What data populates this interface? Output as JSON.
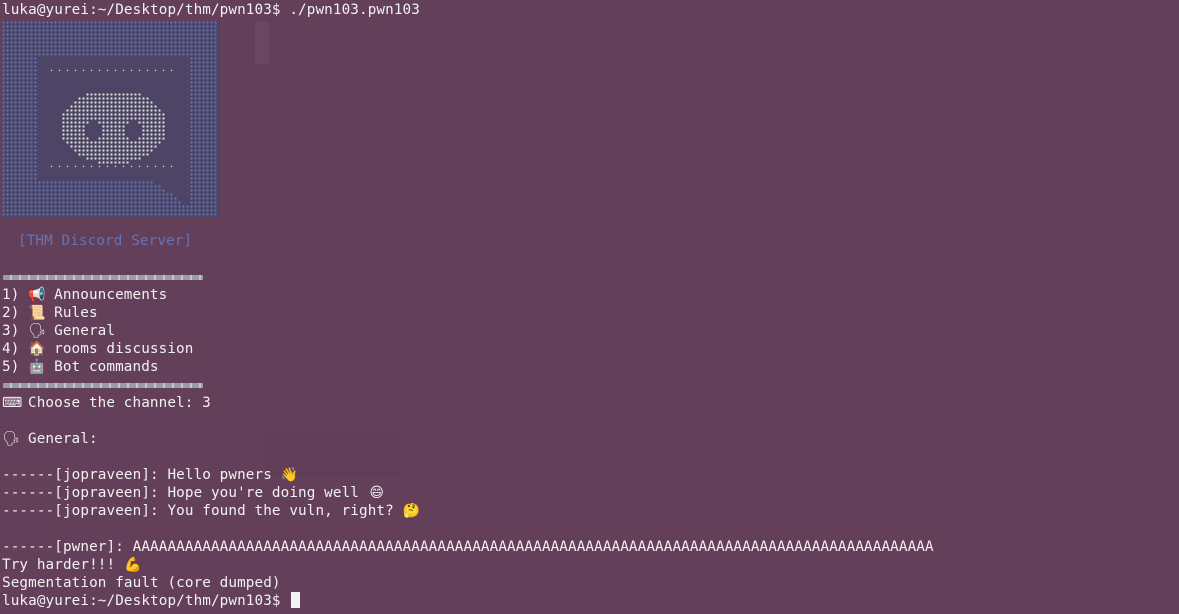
{
  "terminal": {
    "prompt_top": "luka@yurei:~/Desktop/thm/pwn103$ ./pwn103.pwn103",
    "server_name": "[THM Discord Server]",
    "menu": [
      {
        "num": "1)",
        "icon": "megaphone-icon",
        "glyph": "📢",
        "label": "Announcements"
      },
      {
        "num": "2)",
        "icon": "scroll-icon",
        "glyph": "📜",
        "label": "Rules"
      },
      {
        "num": "3)",
        "icon": "speaking-head-icon",
        "glyph": "🗣",
        "label": "General"
      },
      {
        "num": "4)",
        "icon": "house-icon",
        "glyph": "🏠",
        "label": "rooms discussion"
      },
      {
        "num": "5)",
        "icon": "robot-icon",
        "glyph": "🤖",
        "label": "Bot commands"
      }
    ],
    "choose_prompt": "Choose the channel: 3",
    "keyboard_glyph": "⌨",
    "general_glyph": "🗣",
    "general_label": "General:",
    "messages": [
      {
        "text": "------[jopraveen]: Hello pwners",
        "icon": "waving-hand-icon",
        "glyph": "👋"
      },
      {
        "text": "------[jopraveen]: Hope you're doing well",
        "icon": "grinning-face-icon",
        "glyph": "😄"
      },
      {
        "text": "------[jopraveen]: You found the vuln, right?",
        "icon": "thinking-face-icon",
        "glyph": "🤔"
      }
    ],
    "pwner_line": "------[pwner]: AAAAAAAAAAAAAAAAAAAAAAAAAAAAAAAAAAAAAAAAAAAAAAAAAAAAAAAAAAAAAAAAAAAAAAAAAAAAAAAAAAAAAAAAAAAA",
    "try_harder": "Try harder!!!",
    "flexed_glyph": "💪",
    "segfault": "Segmentation fault (core dumped)",
    "prompt_bottom": "luka@yurei:~/Desktop/thm/pwn103$"
  },
  "colors": {
    "background": "#643f5a",
    "text": "#f2f2f2",
    "banner_blue": "#6273b6",
    "banner_dots": "#dcdcdc"
  }
}
